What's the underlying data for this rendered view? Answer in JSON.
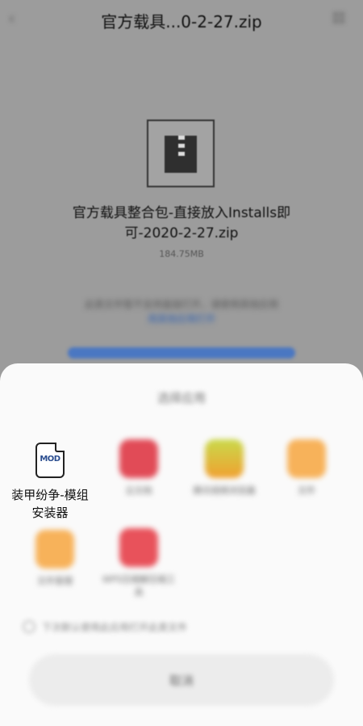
{
  "header": {
    "title": "官方载具...0-2-27.zip"
  },
  "file": {
    "name": "官方载具整合包-直接放入Installs即可-2020-2-27.zip",
    "size": "184.75MB",
    "hint": "此类文件暂不支持直接打开，请使用其他应用",
    "hint_link": "用其他应用打开"
  },
  "sheet": {
    "title": "选择应用",
    "apps": [
      {
        "label": "装甲纷争-模组安装器",
        "icon": "mod-file-icon",
        "icon_text": "MOD",
        "clear": true
      },
      {
        "label": "云文档",
        "icon": "red-app-icon",
        "color": "#e14b57"
      },
      {
        "label": "腾讯视频浏览器",
        "icon": "green-yellow-app-icon",
        "color": "#f0b23a"
      },
      {
        "label": "文件",
        "icon": "folder-icon",
        "color": "#f7b25a"
      },
      {
        "label": "文件管理",
        "icon": "folder-icon",
        "color": "#f7b25a"
      },
      {
        "label": "WPS压缩解压缩工具",
        "icon": "red-square-app-icon",
        "color": "#e8525b"
      }
    ],
    "remember": "下次默认使用此应用打开此类文件",
    "cancel": "取消"
  }
}
